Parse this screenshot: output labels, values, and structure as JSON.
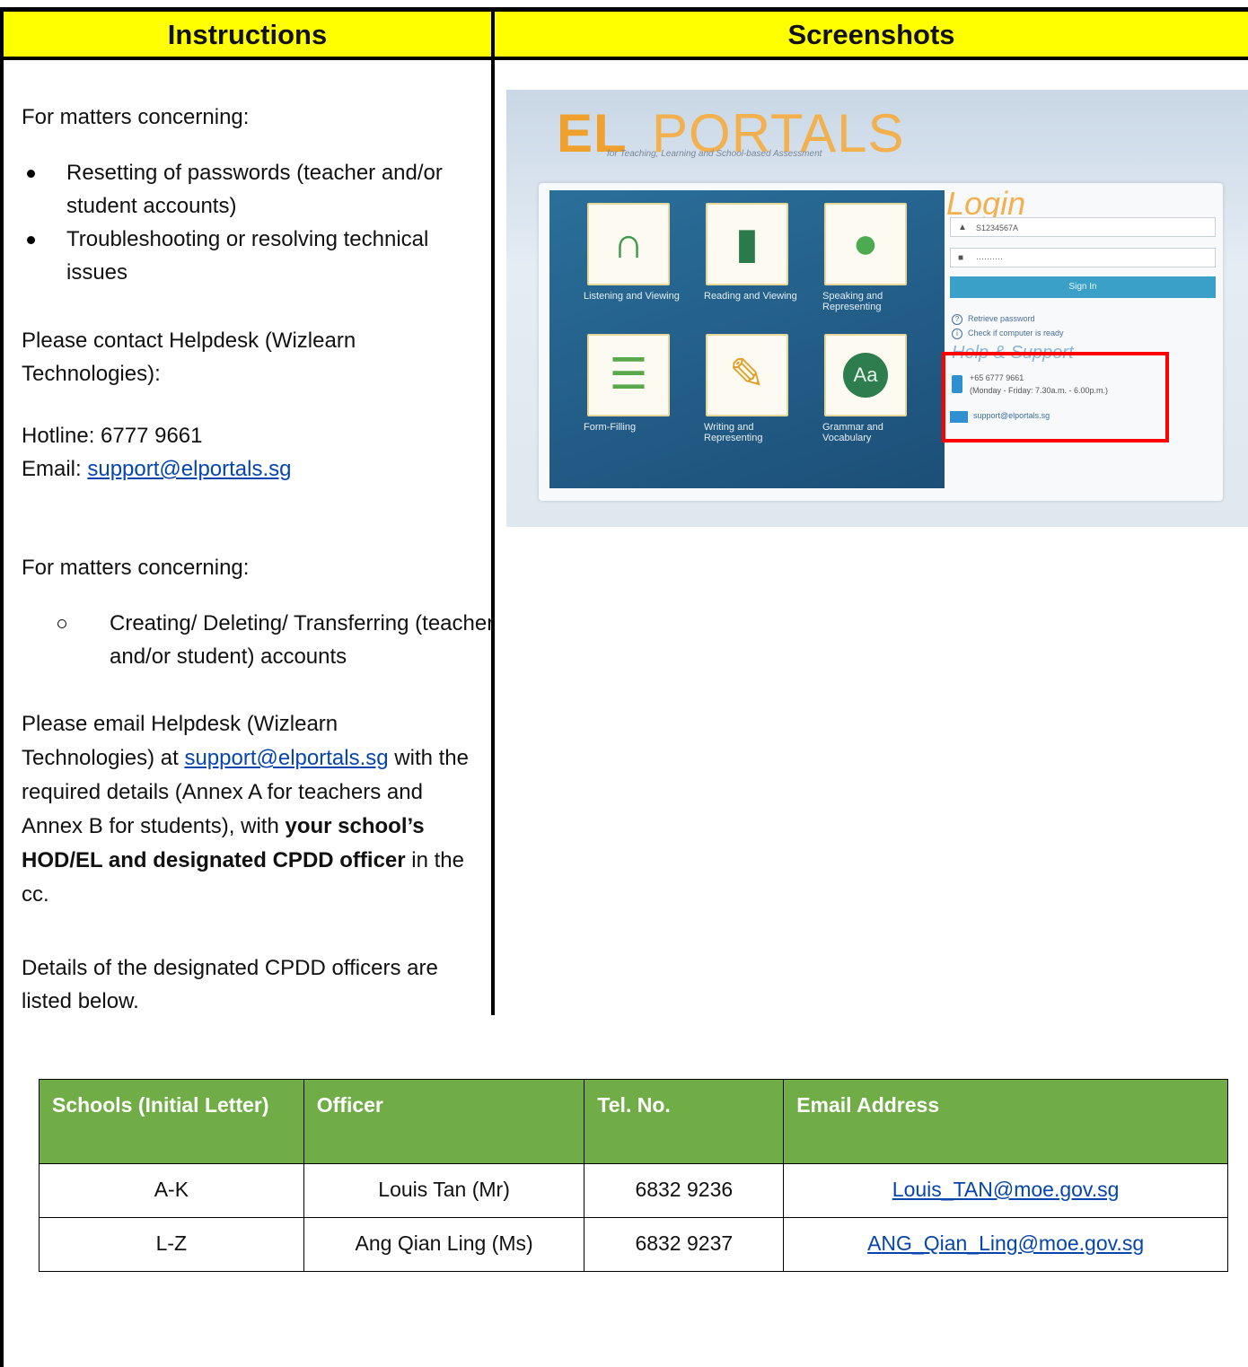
{
  "header": {
    "instructions": "Instructions",
    "screenshots": "Screenshots"
  },
  "instructions": {
    "section1_intro": "For matters concerning:",
    "section1_bullets": [
      "Resetting of passwords (teacher and/or student accounts)",
      "Troubleshooting or resolving technical issues"
    ],
    "contact_intro": "Please contact Helpdesk (Wizlearn Technologies):",
    "hotline": "Hotline: 6777 9661",
    "email_label": "Email: ",
    "email": "support@elportals.sg",
    "section2_intro": "For matters concerning:",
    "section2_bullets": [
      "Creating/ Deleting/ Transferring (teacher and/or student) accounts"
    ],
    "email_para_1": "Please email Helpdesk (Wizlearn Technologies) at ",
    "email_para_link": "support@elportals.sg",
    "email_para_2": " with the required details (Annex A for teachers and Annex B for students), with ",
    "email_para_bold": "your school’s HOD/EL and designated CPDD officer",
    "email_para_3": " in the cc.",
    "details_note": "Details of the designated CPDD officers are listed below."
  },
  "screenshot": {
    "logo_el": "EL",
    "logo_portals": "PORTALS",
    "logo_subtitle": "for Teaching, Learning and School-based Assessment",
    "tiles": [
      {
        "label": "Listening and Viewing",
        "icon": "headphones-icon"
      },
      {
        "label": "Reading and Viewing",
        "icon": "book-icon"
      },
      {
        "label": "Speaking and Representing",
        "icon": "microphone-icon"
      },
      {
        "label": "Form-Filling",
        "icon": "form-icon"
      },
      {
        "label": "Writing and Representing",
        "icon": "pencil-icon"
      },
      {
        "label": "Grammar and Vocabulary",
        "icon": "aa-icon"
      }
    ],
    "login_title": "Login",
    "username_value": "S1234567A",
    "password_value": "··········",
    "signin_label": "Sign In",
    "retrieve_password": "Retrieve password",
    "check_computer": "Check if computer is ready",
    "help_title": "Help & Support",
    "phone": "+65 6777 9661",
    "hours": "(Monday - Friday: 7.30a.m. - 6.00p.m.)",
    "support_email": "support@elportals.sg",
    "highlight_color": "#ff0000"
  },
  "table": {
    "headers": [
      "Schools (Initial Letter)",
      "Officer",
      "Tel. No.",
      "Email Address"
    ],
    "header_color": "#70ad47",
    "rows": [
      {
        "schools": "A-K",
        "officer": "Louis Tan (Mr)",
        "tel": "6832 9236",
        "email": "Louis_TAN@moe.gov.sg"
      },
      {
        "schools": "L-Z",
        "officer": "Ang Qian Ling (Ms)",
        "tel": "6832 9237",
        "email": "ANG_Qian_Ling@moe.gov.sg"
      }
    ]
  }
}
